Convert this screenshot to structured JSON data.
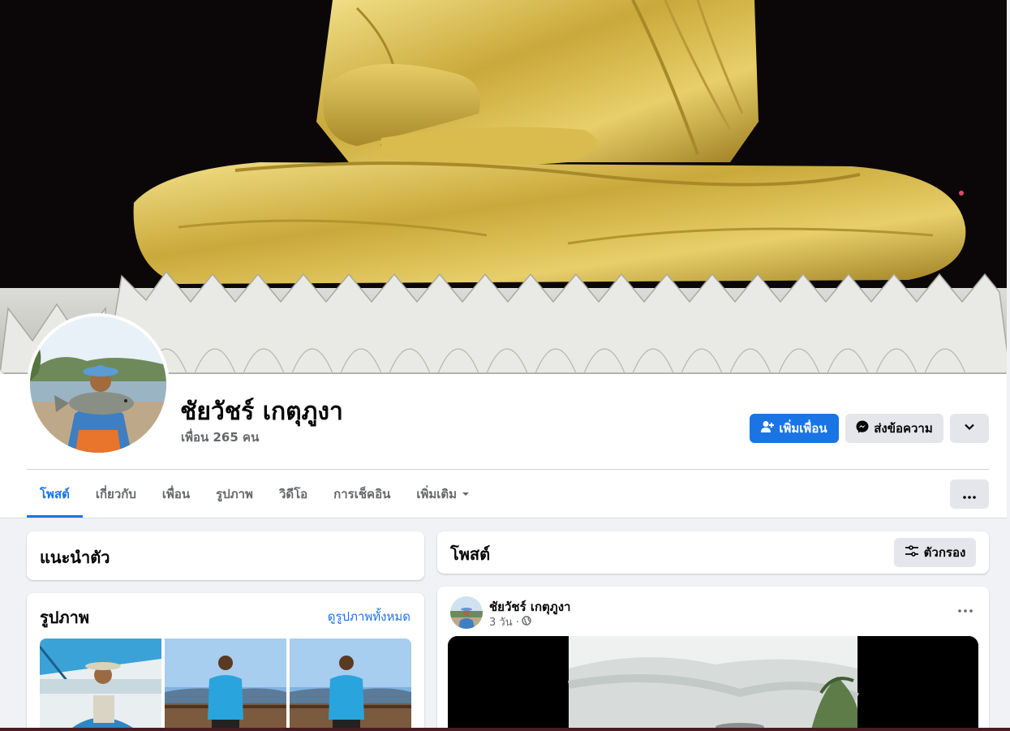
{
  "profile": {
    "name": "ชัยวัชร์ เกตุภูงา",
    "friends": "เพื่อน 265 คน"
  },
  "actions": {
    "add_friend": "เพิ่มเพื่อน",
    "message": "ส่งข้อความ"
  },
  "tabs": [
    {
      "label": "โพสต์",
      "active": true
    },
    {
      "label": "เกี่ยวกับ"
    },
    {
      "label": "เพื่อน"
    },
    {
      "label": "รูปภาพ"
    },
    {
      "label": "วิดีโอ"
    },
    {
      "label": "การเช็คอิน"
    },
    {
      "label": "เพิ่มเติม"
    }
  ],
  "intro": {
    "title": "แนะนำตัว"
  },
  "photos": {
    "title": "รูปภาพ",
    "see_all": "ดูรูปภาพทั้งหมด"
  },
  "posts": {
    "title": "โพสต์",
    "filter": "ตัวกรอง"
  },
  "post": {
    "author": "ชัยวัชร์ เกตุภูงา",
    "time": "3 วัน ·"
  },
  "colors": {
    "accent": "#1b74e4",
    "background": "#f0f2f5",
    "secondary_button": "#e4e6eb",
    "muted_text": "#65676b"
  },
  "icons": [
    "add-friend-icon",
    "messenger-icon",
    "chevron-down-icon",
    "more-dots-icon",
    "filter-icon",
    "globe-icon",
    "caret-down-icon"
  ]
}
